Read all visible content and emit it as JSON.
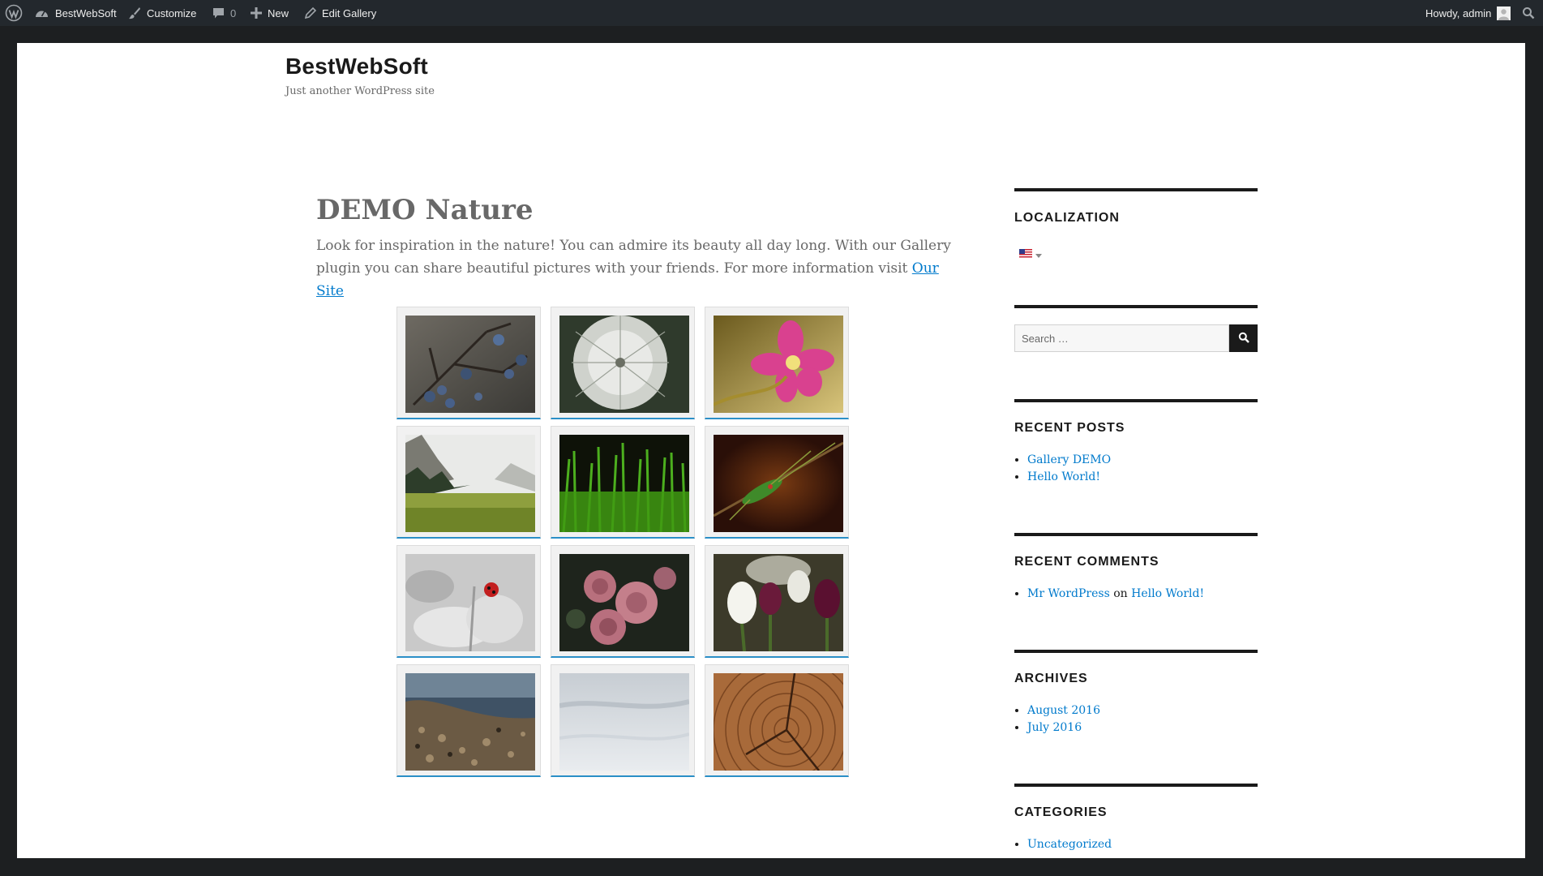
{
  "admin_bar": {
    "site_name": "BestWebSoft",
    "customize": "Customize",
    "comments_count": "0",
    "new_label": "New",
    "edit_label": "Edit Gallery",
    "howdy": "Howdy, admin"
  },
  "site": {
    "title": "BestWebSoft",
    "description": "Just another WordPress site"
  },
  "post": {
    "title": "DEMO Nature",
    "text": "Look for inspiration in the nature! You can admire its beauty all day long. With our Gallery plugin you can share beautiful pictures with your friends. For more information visit ",
    "link_text": "Our Site"
  },
  "gallery": {
    "photos": [
      "blueberries-branch",
      "dandelion",
      "pink-flower",
      "mountain-meadow",
      "green-grass",
      "grasshopper",
      "ladybug",
      "pink-roses",
      "white-tulips",
      "pebble-shore",
      "snow",
      "tree-rings"
    ]
  },
  "sidebar": {
    "localization_title": "LOCALIZATION",
    "flag": "us-flag-icon",
    "search_placeholder": "Search …",
    "recent_posts_title": "RECENT POSTS",
    "recent_posts": [
      "Gallery DEMO",
      "Hello World!"
    ],
    "recent_comments_title": "RECENT COMMENTS",
    "comment_author": "Mr WordPress",
    "comment_on": "on",
    "comment_post": "Hello World!",
    "archives_title": "ARCHIVES",
    "archives": [
      "August 2016",
      "July 2016"
    ],
    "categories_title": "CATEGORIES",
    "categories": [
      "Uncategorized"
    ]
  },
  "colors": {
    "link": "#007acc",
    "admin_bar": "#23282d",
    "frame": "#1d1f21"
  }
}
